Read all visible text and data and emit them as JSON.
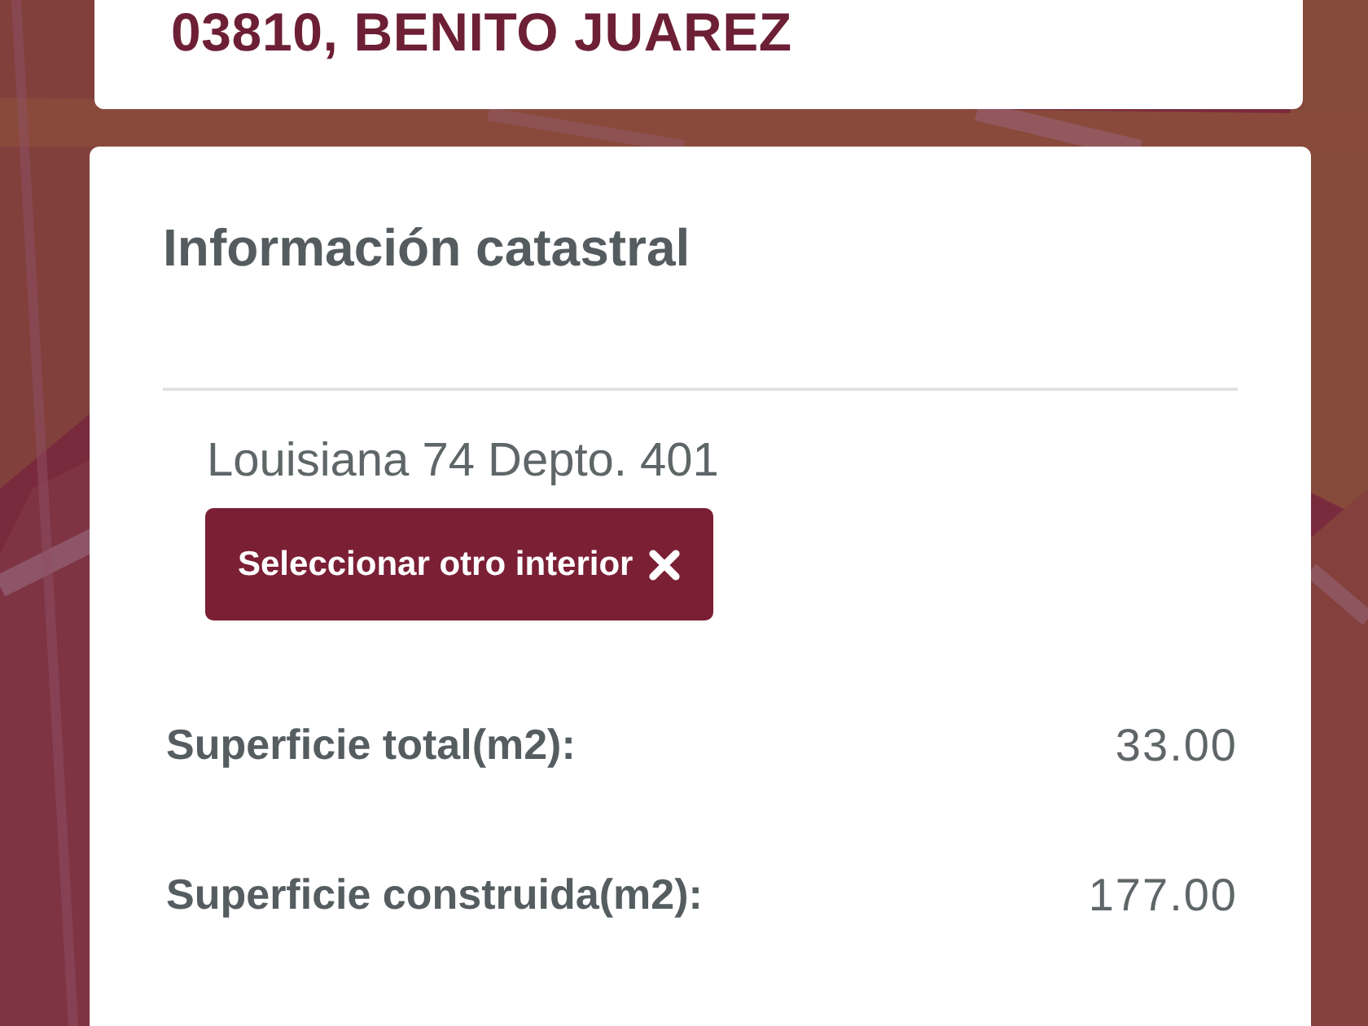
{
  "header": {
    "title": "03810, BENITO JUAREZ"
  },
  "panel": {
    "title": "Información catastral",
    "address": "Louisiana 74 Depto. 401",
    "button": {
      "label": "Seleccionar otro interior"
    },
    "fields": [
      {
        "label": "Superficie total(m2):",
        "value": "33.00"
      },
      {
        "label": "Superficie construida(m2):",
        "value": "177.00"
      }
    ]
  }
}
